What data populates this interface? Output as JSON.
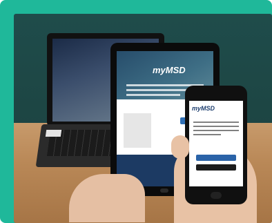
{
  "scene": {
    "description_labels": {
      "brand": "myMSD"
    }
  }
}
